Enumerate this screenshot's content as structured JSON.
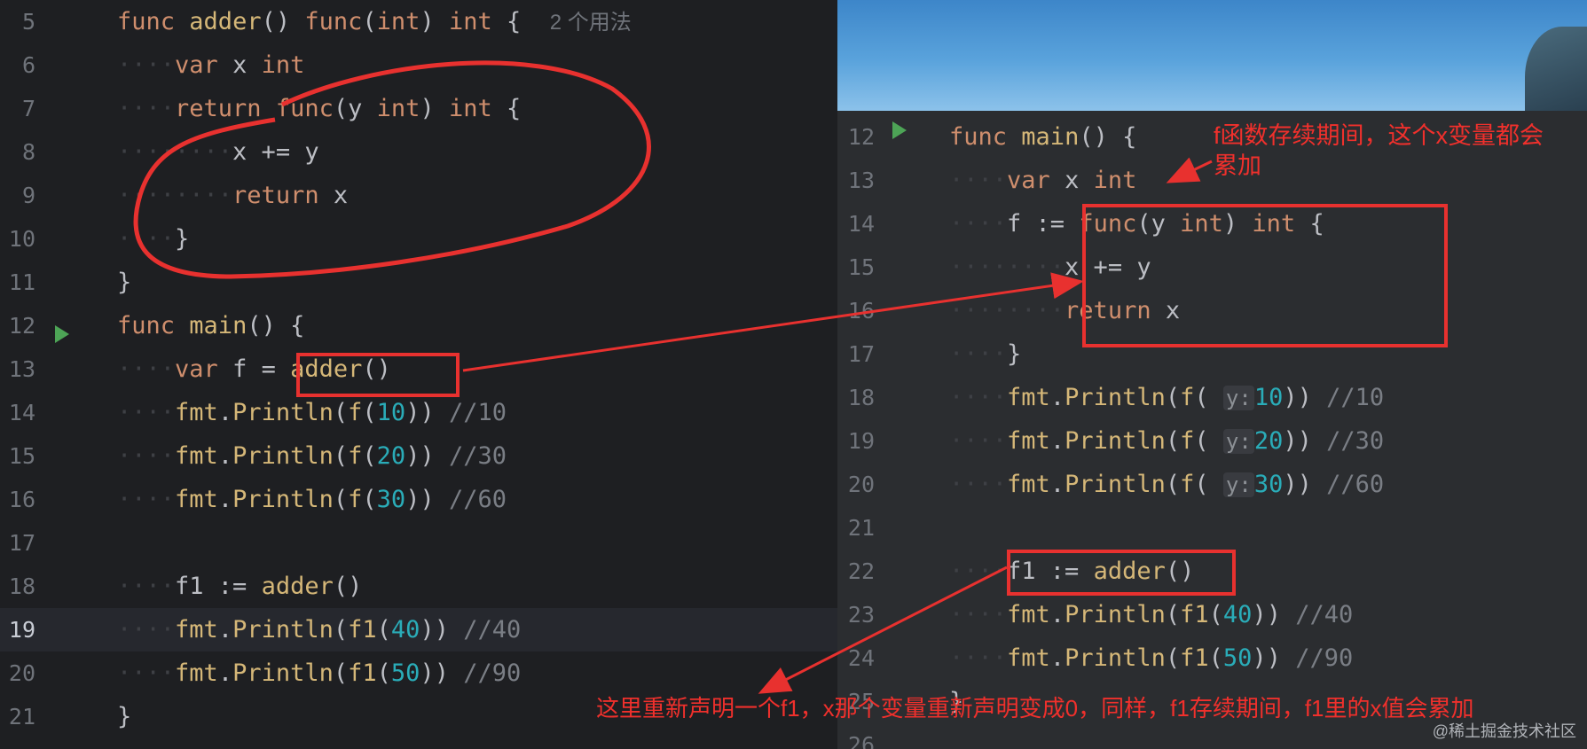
{
  "left_editor": {
    "lines": [
      {
        "n": "5",
        "html": "<span class='kw'>func</span> <span class='fnd'>adder</span>() <span class='kw'>func</span>(<span class='tp'>int</span>) <span class='tp'>int</span> {  <span class='hint'>2 个用法</span>"
      },
      {
        "n": "6",
        "html": "<span class='indent'>····</span><span class='kw'>var</span> x <span class='tp'>int</span>"
      },
      {
        "n": "7",
        "html": "<span class='indent'>····</span><span class='kw'>return</span> <span class='kw'>func</span>(y <span class='tp'>int</span>) <span class='tp'>int</span> {"
      },
      {
        "n": "8",
        "html": "<span class='indent'>········</span>x += y"
      },
      {
        "n": "9",
        "html": "<span class='indent'>········</span><span class='kw'>return</span> x"
      },
      {
        "n": "10",
        "html": "<span class='indent'>····</span>}"
      },
      {
        "n": "11",
        "html": "}"
      },
      {
        "n": "12",
        "html": "<span class='kw'>func</span> <span class='fnd'>main</span>() {"
      },
      {
        "n": "13",
        "html": "<span class='indent'>····</span><span class='kw'>var</span> f = <span class='fnd'>adder</span>()"
      },
      {
        "n": "14",
        "html": "<span class='indent'>····</span><span class='fnd'>fmt</span>.<span class='fnd'>Println</span>(<span class='fnd'>f</span>(<span class='num'>10</span>)) <span class='cm'>//10</span>"
      },
      {
        "n": "15",
        "html": "<span class='indent'>····</span><span class='fnd'>fmt</span>.<span class='fnd'>Println</span>(<span class='fnd'>f</span>(<span class='num'>20</span>)) <span class='cm'>//30</span>"
      },
      {
        "n": "16",
        "html": "<span class='indent'>····</span><span class='fnd'>fmt</span>.<span class='fnd'>Println</span>(<span class='fnd'>f</span>(<span class='num'>30</span>)) <span class='cm'>//60</span>"
      },
      {
        "n": "17",
        "html": ""
      },
      {
        "n": "18",
        "html": "<span class='indent'>····</span>f1 := <span class='fnd'>adder</span>()"
      },
      {
        "n": "19",
        "html": "<span class='indent'>····</span><span class='fnd'>fmt</span>.<span class='fnd'>Println</span>(<span class='fnd'>f1</span>(<span class='num'>40</span>)) <span class='cm'>//40</span>"
      },
      {
        "n": "20",
        "html": "<span class='indent'>····</span><span class='fnd'>fmt</span>.<span class='fnd'>Println</span>(<span class='fnd'>f1</span>(<span class='num'>50</span>)) <span class='cm'>//90</span>"
      },
      {
        "n": "21",
        "html": "}"
      }
    ],
    "active_line": "19",
    "usage_hint": "2 个用法"
  },
  "right_editor": {
    "lines": [
      {
        "n": "12",
        "html": "<span class='kw'>func</span> <span class='fnd'>main</span>() {"
      },
      {
        "n": "13",
        "html": "<span class='indent'>····</span><span class='kw'>var</span> x <span class='tp'>int</span>"
      },
      {
        "n": "14",
        "html": "<span class='indent'>····</span>f := <span class='kw'>func</span>(y <span class='tp'>int</span>) <span class='tp'>int</span> {"
      },
      {
        "n": "15",
        "html": "<span class='indent'>········</span>x += y"
      },
      {
        "n": "16",
        "html": "<span class='indent'>········</span><span class='kw'>return</span> x"
      },
      {
        "n": "17",
        "html": "<span class='indent'>····</span>}"
      },
      {
        "n": "18",
        "html": "<span class='indent'>····</span><span class='fnd'>fmt</span>.<span class='fnd'>Println</span>(<span class='fnd'>f</span>( <span class='ph'>y:</span><span class='num'>10</span>)) <span class='cm'>//10</span>"
      },
      {
        "n": "19",
        "html": "<span class='indent'>····</span><span class='fnd'>fmt</span>.<span class='fnd'>Println</span>(<span class='fnd'>f</span>( <span class='ph'>y:</span><span class='num'>20</span>)) <span class='cm'>//30</span>"
      },
      {
        "n": "20",
        "html": "<span class='indent'>····</span><span class='fnd'>fmt</span>.<span class='fnd'>Println</span>(<span class='fnd'>f</span>( <span class='ph'>y:</span><span class='num'>30</span>)) <span class='cm'>//60</span>"
      },
      {
        "n": "21",
        "html": ""
      },
      {
        "n": "22",
        "html": "<span class='indent'>····</span>f1 := <span class='fnd'>adder</span>()"
      },
      {
        "n": "23",
        "html": "<span class='indent'>····</span><span class='fnd'>fmt</span>.<span class='fnd'>Println</span>(<span class='fnd'>f1</span>(<span class='num'>40</span>)) <span class='cm'>//40</span>"
      },
      {
        "n": "24",
        "html": "<span class='indent'>····</span><span class='fnd'>fmt</span>.<span class='fnd'>Println</span>(<span class='fnd'>f1</span>(<span class='num'>50</span>)) <span class='cm'>//90</span>"
      },
      {
        "n": "25",
        "html": "}"
      },
      {
        "n": "26",
        "html": ""
      }
    ]
  },
  "annotations": {
    "top_note_line1": "f函数存续期间，这个x变量都会",
    "top_note_line2": "累加",
    "bottom_note": "这里重新声明一个f1，x那个变量重新声明变成0，同样，f1存续期间，f1里的x值会累加"
  },
  "watermark": "@稀土掘金技术社区",
  "colors": {
    "annotation_red": "#e8312f",
    "editor_bg": "#1e1f22",
    "keyword": "#cf8e6d"
  }
}
